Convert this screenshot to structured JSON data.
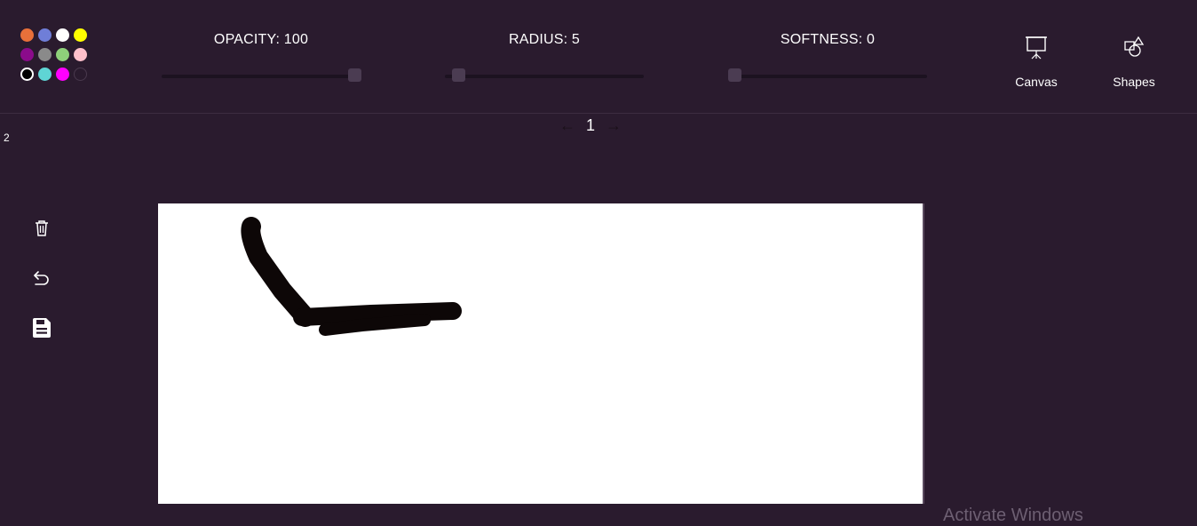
{
  "palette": {
    "colors": [
      {
        "hex": "#e8703a",
        "name": "orange"
      },
      {
        "hex": "#6f7ed8",
        "name": "blue"
      },
      {
        "hex": "#ffffff",
        "name": "white"
      },
      {
        "hex": "#ffff00",
        "name": "yellow"
      },
      {
        "hex": "#8b0b8b",
        "name": "purple"
      },
      {
        "hex": "#8a8a8a",
        "name": "gray"
      },
      {
        "hex": "#8ed07a",
        "name": "green"
      },
      {
        "hex": "#ffc0cb",
        "name": "pink"
      },
      {
        "hex": "#000000",
        "name": "black",
        "selected": true
      },
      {
        "hex": "#5fd5d5",
        "name": "cyan"
      },
      {
        "hex": "#ff00ff",
        "name": "magenta"
      },
      {
        "hex": "#2a1b2e",
        "name": "background"
      }
    ]
  },
  "controls": {
    "opacity": {
      "label": "OPACITY: 100",
      "value": 100,
      "min": 0,
      "max": 100
    },
    "radius": {
      "label": "RADIUS: 5",
      "value": 5,
      "min": 1,
      "max": 100
    },
    "softness": {
      "label": "SOFTNESS: 0",
      "value": 0,
      "min": 0,
      "max": 100
    }
  },
  "tools": {
    "canvas_label": "Canvas",
    "shapes_label": "Shapes",
    "canvas_icon": "presentation-board-icon",
    "shapes_icon": "shapes-icon"
  },
  "pager": {
    "prev": "←",
    "page": "1",
    "next": "→"
  },
  "side": {
    "label": "2",
    "delete_icon": "trash-icon",
    "undo_icon": "undo-icon",
    "save_icon": "save-icon"
  },
  "drawing": {
    "stroke_color": "#0d0707"
  },
  "watermark": "Activate Windows",
  "colors": {
    "background": "#2a1b2e",
    "text": "#ffffff",
    "canvas": "#ffffff"
  }
}
